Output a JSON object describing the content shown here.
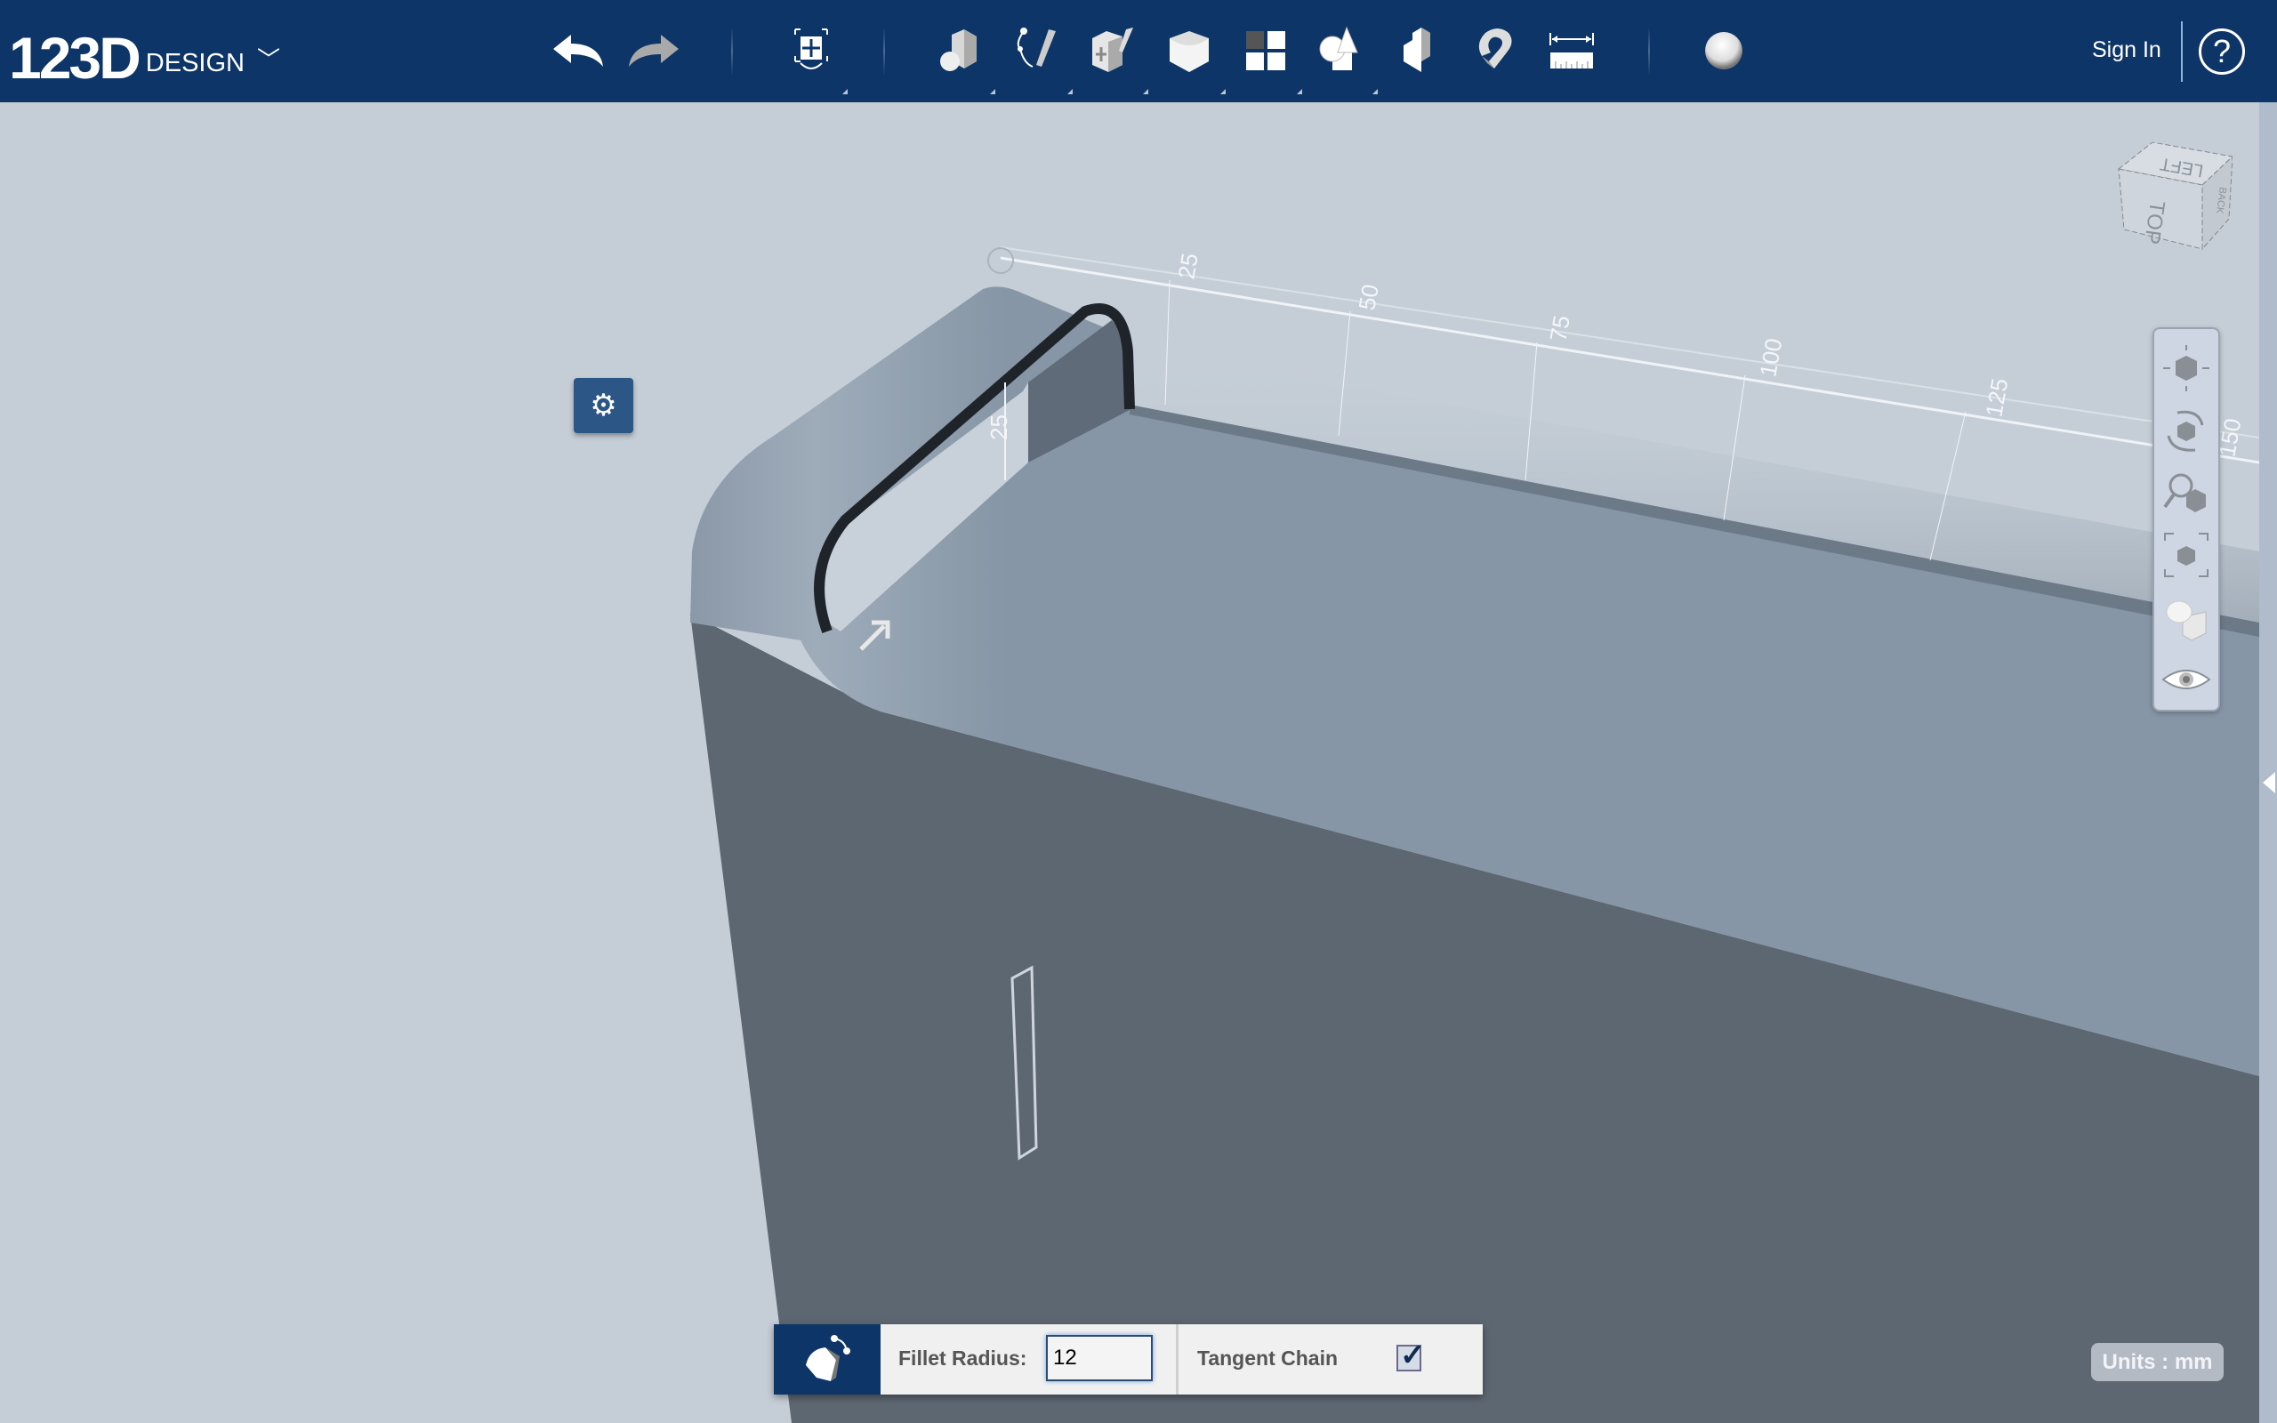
{
  "app": {
    "logo_main": "123D",
    "logo_sub": "DESIGN",
    "logo_chevron": "﹀"
  },
  "toolbar": {
    "items": [
      {
        "name": "undo-icon"
      },
      {
        "name": "redo-icon"
      },
      {
        "name": "transform-icon"
      },
      {
        "name": "primitives-icon"
      },
      {
        "name": "sketch-icon"
      },
      {
        "name": "construct-icon"
      },
      {
        "name": "modify-icon"
      },
      {
        "name": "pattern-icon"
      },
      {
        "name": "grouping-icon"
      },
      {
        "name": "combine-icon"
      },
      {
        "name": "snap-icon"
      },
      {
        "name": "measure-icon"
      },
      {
        "name": "material-icon"
      }
    ],
    "sign_in": "Sign In",
    "help": "?"
  },
  "viewport": {
    "gear": "⚙",
    "ruler_ticks": [
      "25",
      "50",
      "75",
      "100",
      "125",
      "150"
    ],
    "ruler_vertical_tick": "25",
    "viewcube": {
      "top": "TOP",
      "left": "LEFT",
      "back": "BACK"
    }
  },
  "fillet_panel": {
    "radius_label": "Fillet Radius:",
    "radius_value": "12",
    "tangent_label": "Tangent Chain",
    "tangent_checked": true,
    "check_glyph": "✓"
  },
  "units": "Units : mm",
  "colors": {
    "topbar": "#0e3567",
    "background": "#c5ced7",
    "top_face": "#8796a6",
    "front_face": "#5d6772"
  }
}
